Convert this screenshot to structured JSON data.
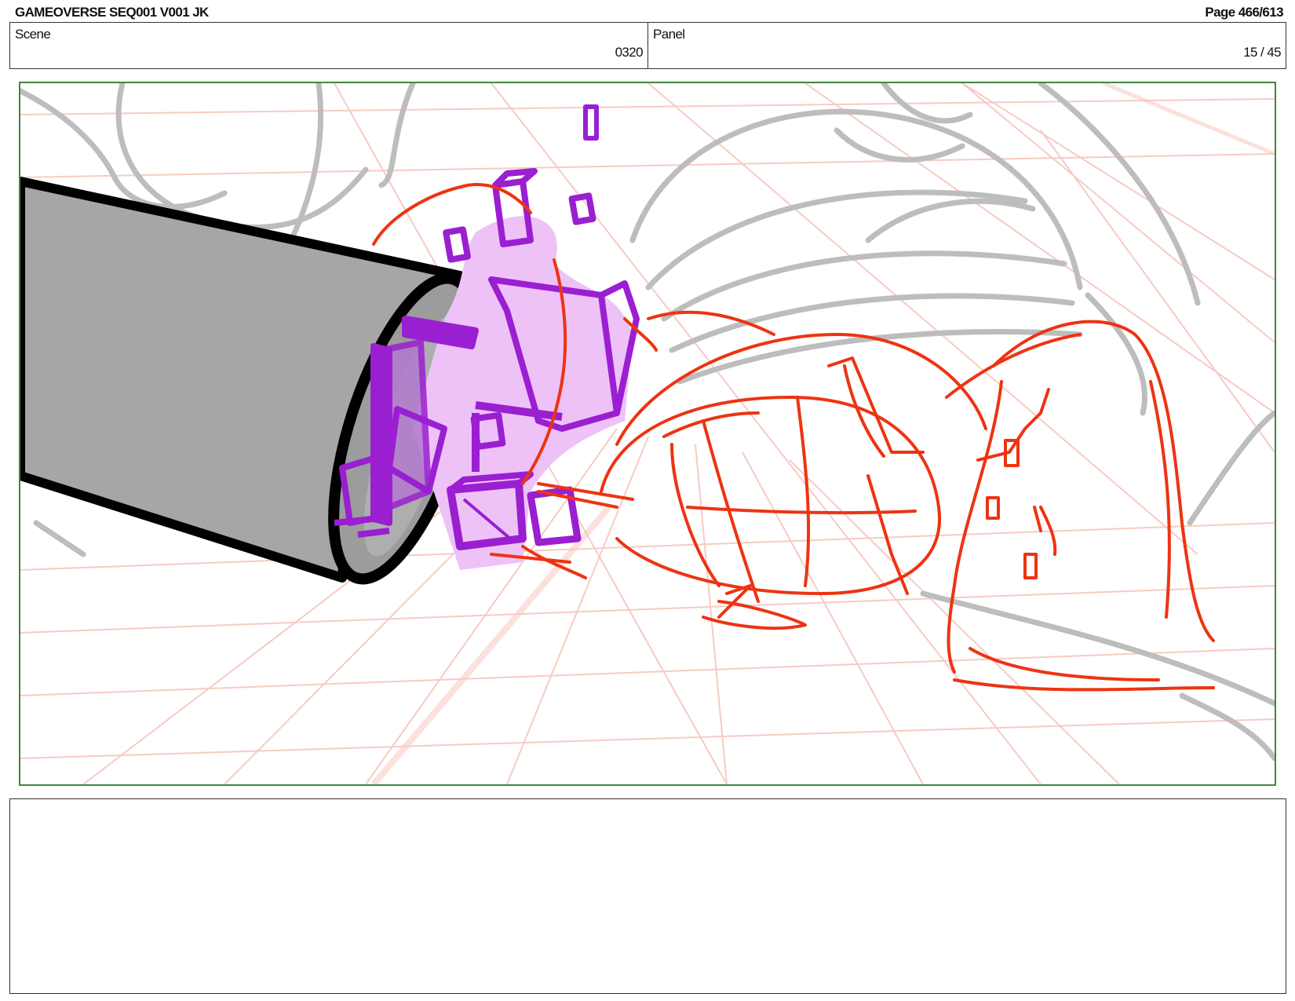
{
  "header": {
    "title": "GAMEOVERSE SEQ001 V001 JK",
    "page": "Page 466/613"
  },
  "info": {
    "scene_label": "Scene",
    "scene_value": "0320",
    "panel_label": "Panel",
    "panel_value": "15 / 45"
  },
  "panel": {
    "frame_color": "#3a8a3a",
    "layers": [
      "perspective-grid",
      "background-sketch",
      "cylinder-barrel",
      "purple-debris",
      "red-blob-creatures"
    ],
    "colors": {
      "grid": "#f6c6bd",
      "background_sketch": "#bdbdbd",
      "barrel_fill": "#a6a6a6",
      "barrel_outline": "#000000",
      "debris": "#9a1fd1",
      "debris_fill": "#eec2f7",
      "creatures": "#ee3312"
    }
  },
  "notes": {
    "text": ""
  }
}
